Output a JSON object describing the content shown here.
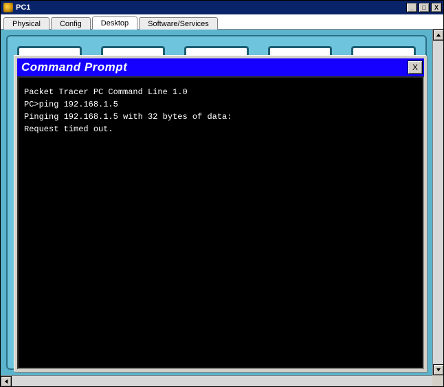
{
  "window": {
    "title": "PC1",
    "minimize_label": "_",
    "maximize_label": "□",
    "close_label": "X"
  },
  "tabs": [
    {
      "label": "Physical",
      "active": false
    },
    {
      "label": "Config",
      "active": false
    },
    {
      "label": "Desktop",
      "active": true
    },
    {
      "label": "Software/Services",
      "active": false
    }
  ],
  "command_prompt": {
    "title": "Command Prompt",
    "close_label": "X",
    "lines": [
      "Packet Tracer PC Command Line 1.0",
      "PC>ping 192.168.1.5",
      "",
      "Pinging 192.168.1.5 with 32 bytes of data:",
      "",
      "Request timed out."
    ]
  }
}
